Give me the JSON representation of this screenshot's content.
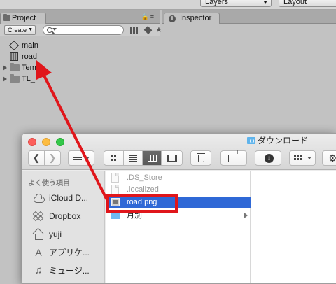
{
  "unity": {
    "topbar": {
      "layers_label": "Layers",
      "layout_label": "Layout"
    },
    "project": {
      "tab_label": "Project",
      "create_label": "Create",
      "tree": [
        {
          "label": "main",
          "icon": "unity-scene-icon",
          "expandable": false
        },
        {
          "label": "road",
          "icon": "texture-icon",
          "expandable": false
        },
        {
          "label": "Tem",
          "icon": "folder-icon",
          "expandable": true
        },
        {
          "label": "TL_",
          "icon": "folder-icon",
          "expandable": true
        }
      ]
    },
    "inspector": {
      "tab_label": "Inspector"
    }
  },
  "finder": {
    "title": "ダウンロード",
    "sidebar": {
      "heading": "よく使う項目",
      "items": [
        {
          "label": "iCloud D...",
          "icon": "cloud-icon"
        },
        {
          "label": "Dropbox",
          "icon": "dropbox-icon"
        },
        {
          "label": "yuji",
          "icon": "home-icon"
        },
        {
          "label": "アプリケ...",
          "icon": "apps-icon"
        },
        {
          "label": "ミュージ...",
          "icon": "music-icon"
        }
      ]
    },
    "files": [
      {
        "name": ".DS_Store",
        "dimmed": true,
        "selected": false,
        "icon": "document-icon"
      },
      {
        "name": ".localized",
        "dimmed": true,
        "selected": false,
        "icon": "document-icon"
      },
      {
        "name": "road.png",
        "dimmed": false,
        "selected": true,
        "icon": "png-file-icon"
      },
      {
        "name": "月別",
        "dimmed": false,
        "selected": false,
        "icon": "folder-icon",
        "has_children": true
      }
    ]
  },
  "annotation": {
    "arrow_color": "#e0161b",
    "highlight_color": "#e0161b"
  },
  "colors": {
    "selection": "#2f68d6",
    "unity_panel": "#c2c2c2"
  }
}
